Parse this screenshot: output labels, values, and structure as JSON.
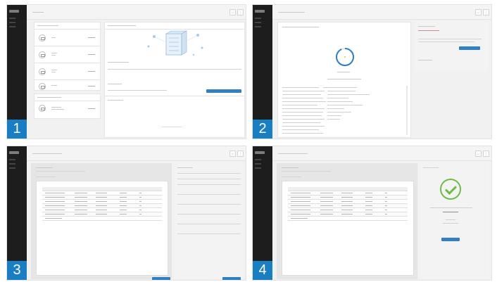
{
  "steps": [
    {
      "number": "1"
    },
    {
      "number": "2"
    },
    {
      "number": "3"
    },
    {
      "number": "4"
    }
  ],
  "colors": {
    "accent": "#1a7ec2",
    "button": "#2f7fc2",
    "success": "#6bbd45",
    "sidebar": "#1d1d1d"
  },
  "icons": [
    "user-icon",
    "settings-icon",
    "checkmark-icon",
    "progress-ring-icon",
    "server-icon"
  ]
}
